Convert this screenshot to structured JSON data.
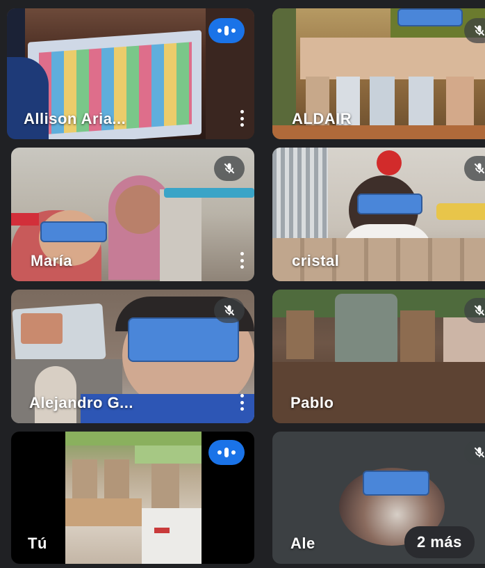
{
  "participants": [
    {
      "name": "Allison Aria...",
      "has_menu": true,
      "status": "speaking"
    },
    {
      "name": "ALDAIR",
      "has_menu": false,
      "status": "muted"
    },
    {
      "name": "María",
      "has_menu": true,
      "status": "muted"
    },
    {
      "name": "cristal",
      "has_menu": false,
      "status": "muted"
    },
    {
      "name": "Alejandro G...",
      "has_menu": true,
      "status": "muted"
    },
    {
      "name": "Pablo",
      "has_menu": false,
      "status": "muted"
    },
    {
      "name": "Tú",
      "has_menu": false,
      "status": "speaking"
    },
    {
      "name": "Ale",
      "has_menu": false,
      "status": "muted"
    }
  ],
  "overflow": {
    "label": "2 más"
  },
  "colors": {
    "background": "#202124",
    "tile": "#3c4043",
    "speaking_indicator": "#1a73e8",
    "redaction": "#4a86d9"
  },
  "icons": {
    "speaking": "audio-level-icon",
    "muted": "mic-off-icon",
    "menu": "more-vert-icon"
  }
}
